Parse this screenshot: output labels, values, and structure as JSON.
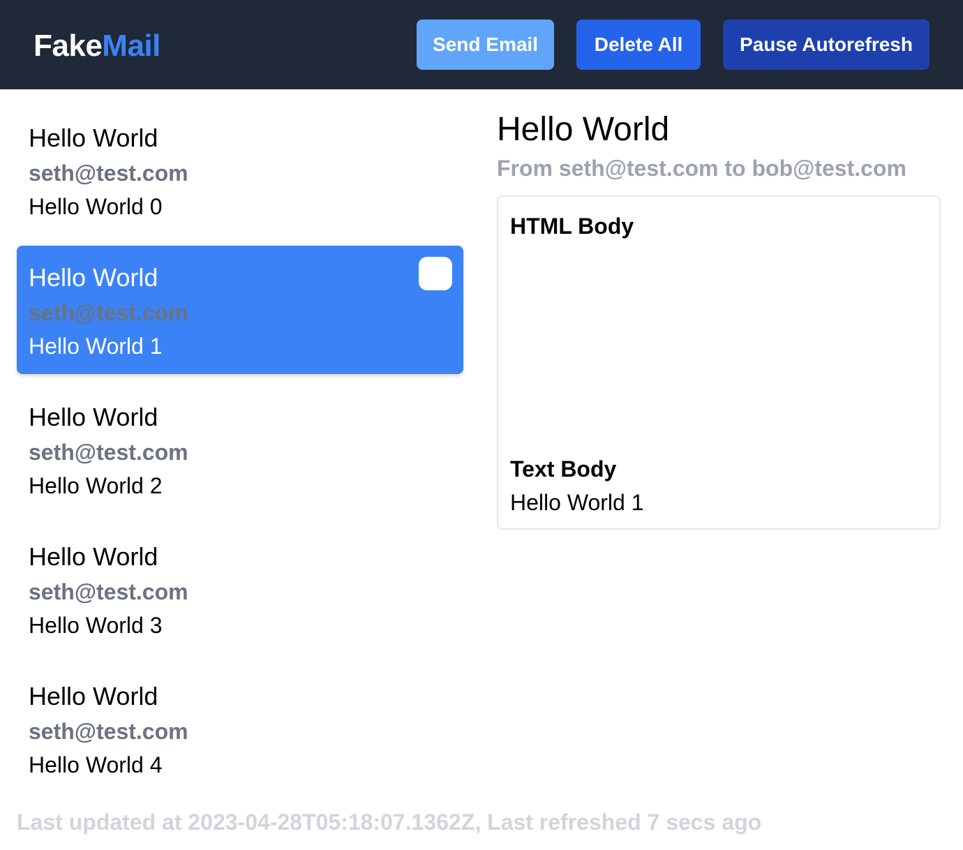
{
  "header": {
    "logo_part1": "Fake",
    "logo_part2": "Mail",
    "send_label": "Send Email",
    "delete_label": "Delete All",
    "pause_label": "Pause Autorefresh"
  },
  "emails": [
    {
      "subject": "Hello World",
      "from": "seth@test.com",
      "preview": "Hello World 0"
    },
    {
      "subject": "Hello World",
      "from": "seth@test.com",
      "preview": "Hello World 1"
    },
    {
      "subject": "Hello World",
      "from": "seth@test.com",
      "preview": "Hello World 2"
    },
    {
      "subject": "Hello World",
      "from": "seth@test.com",
      "preview": "Hello World 3"
    },
    {
      "subject": "Hello World",
      "from": "seth@test.com",
      "preview": "Hello World 4"
    }
  ],
  "selected_index": 1,
  "detail": {
    "subject": "Hello World",
    "meta": "From seth@test.com to bob@test.com",
    "html_label": "HTML Body",
    "text_label": "Text Body",
    "text_content": "Hello World 1"
  },
  "footer": {
    "status": "Last updated at 2023-04-28T05:18:07.1362Z, Last refreshed 7 secs ago"
  },
  "colors": {
    "header_bg": "#1f2937",
    "accent": "#3b82f6",
    "send_button": "#60a5fa",
    "delete_button": "#2563eb",
    "pause_button": "#1e40af"
  }
}
